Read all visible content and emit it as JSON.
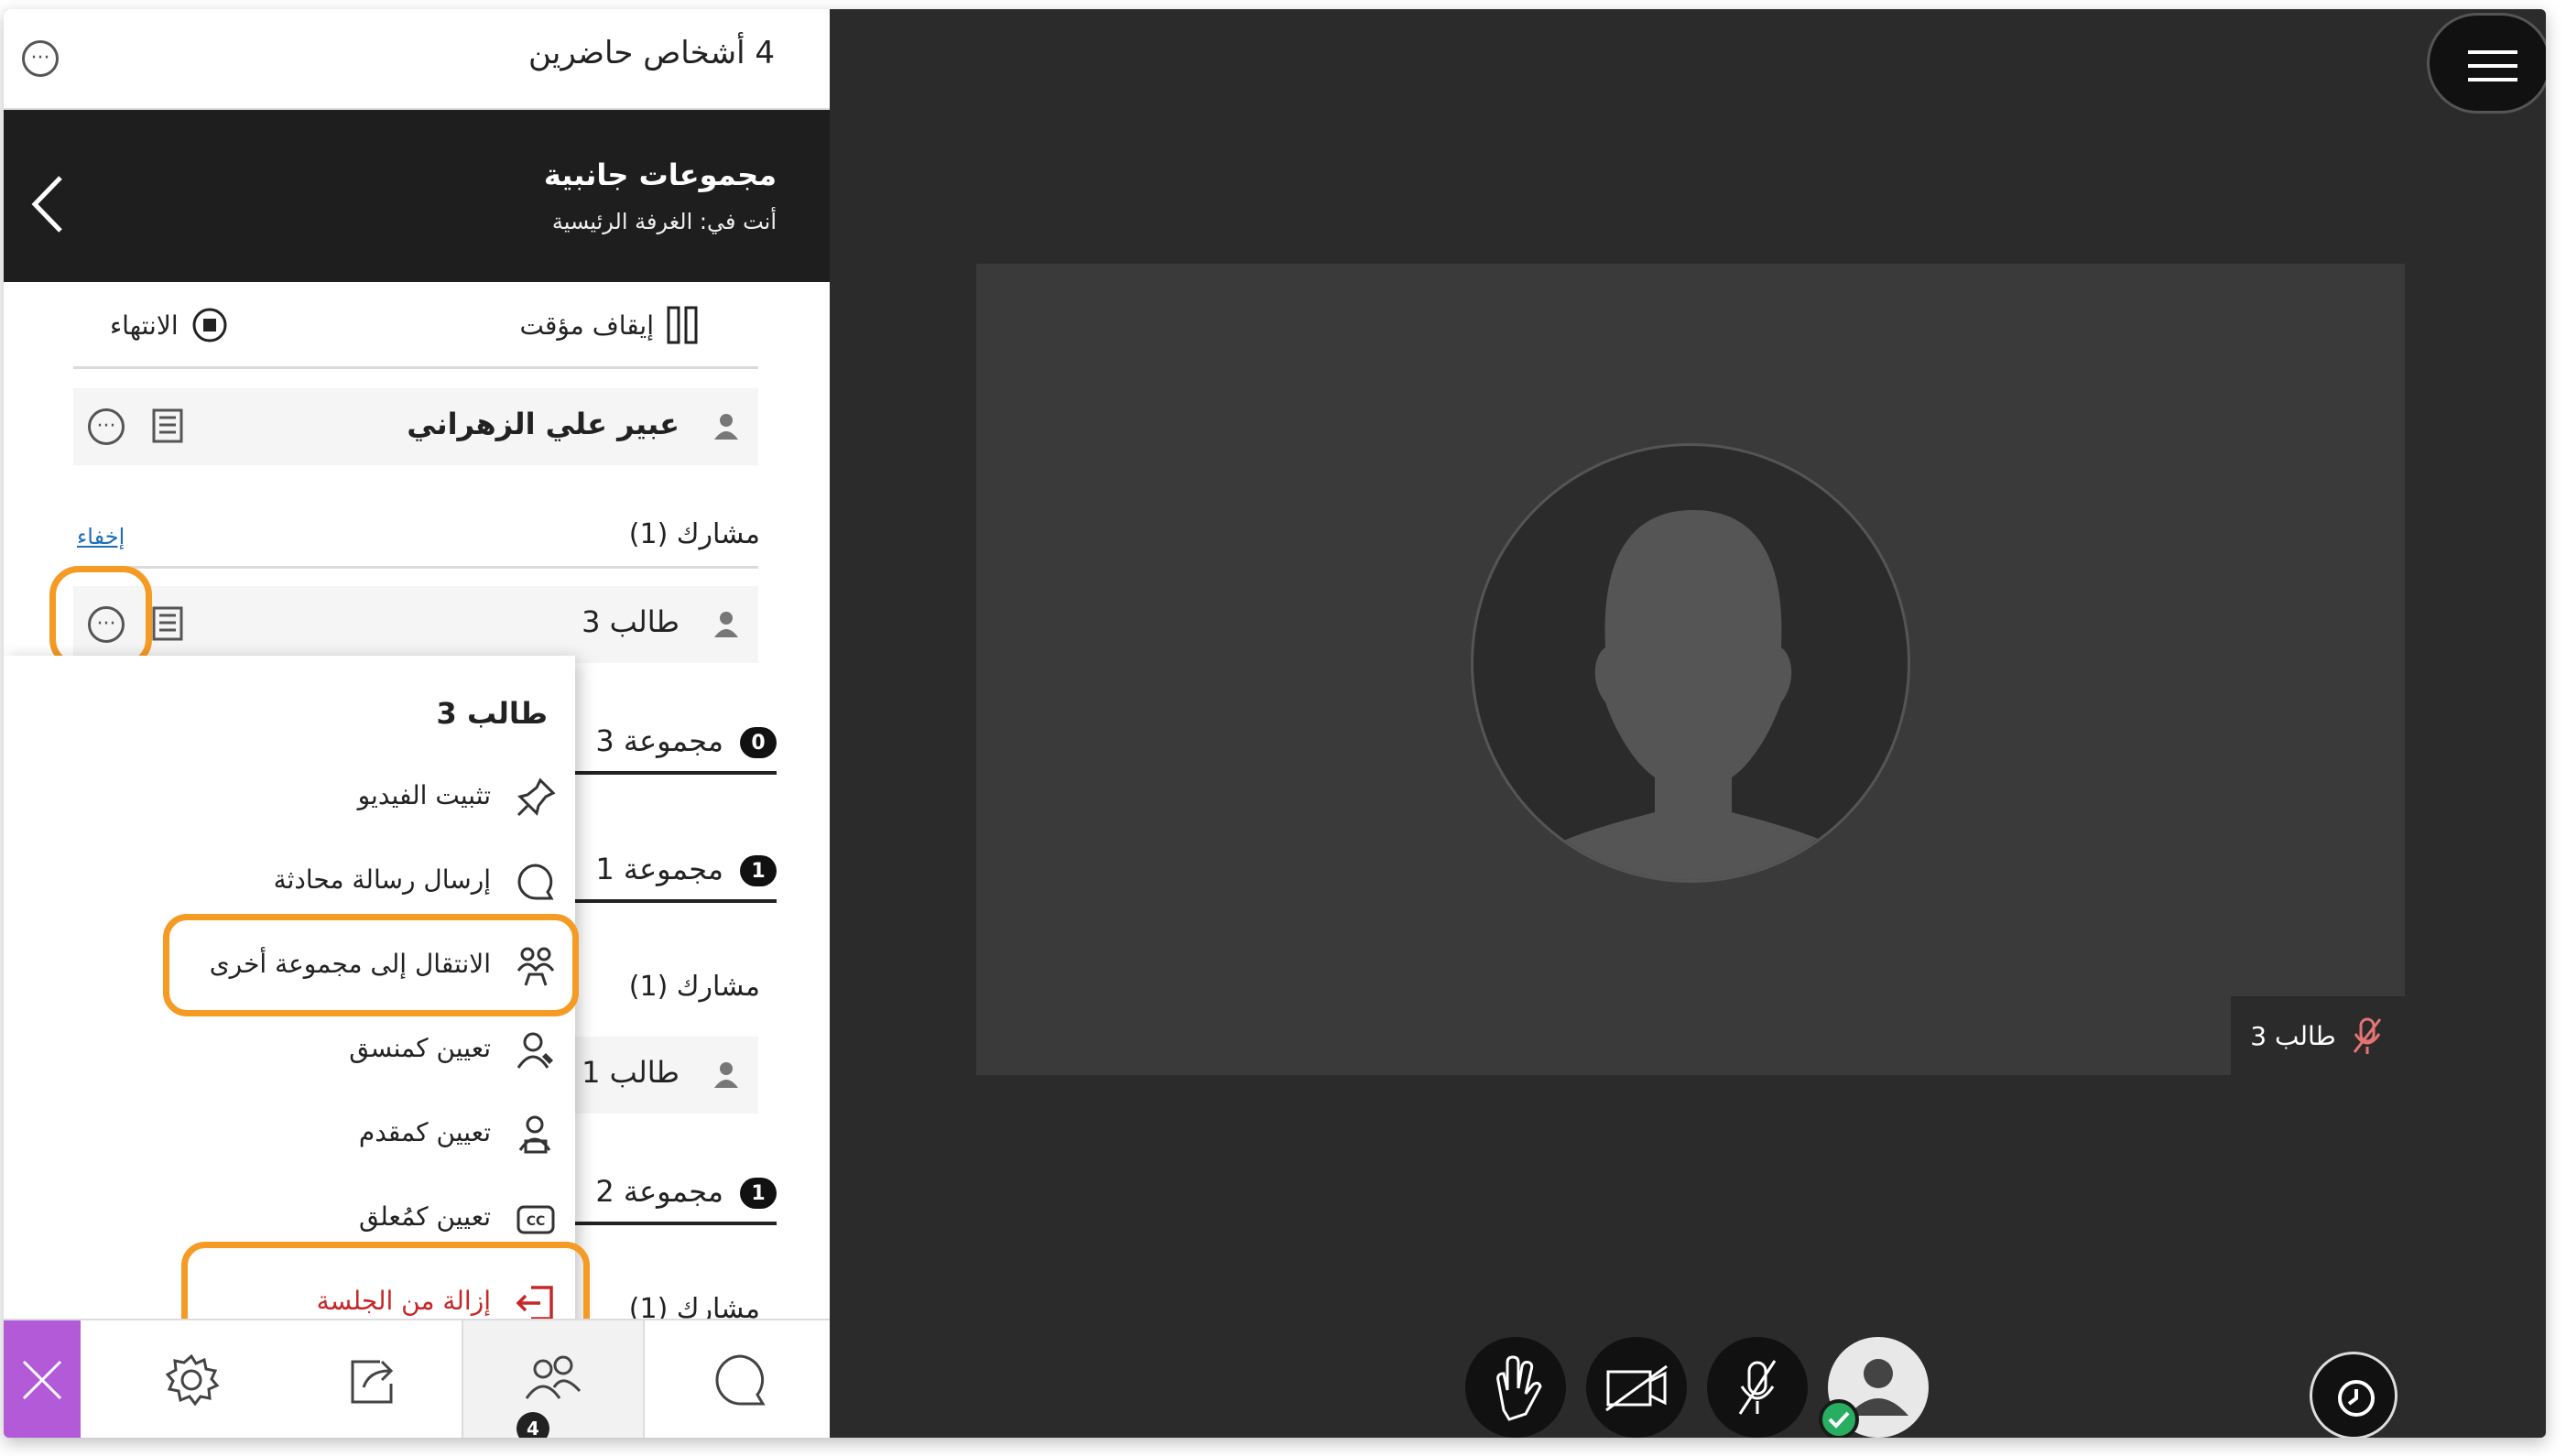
{
  "header": {
    "attendees_title": "4 أشخاص حاضرين"
  },
  "breakout": {
    "title": "مجموعات جانبية",
    "location": "أنت في: الغرفة الرئيسية"
  },
  "controls": {
    "pause_label": "إيقاف مؤقت",
    "end_label": "الانتهاء"
  },
  "facilitator": {
    "name": "عبير علي الزهراني"
  },
  "main_room": {
    "section_label": "مشارك (1)",
    "hide_label": "إخفاء",
    "participant": "طالب 3"
  },
  "groups": [
    {
      "badge": "0",
      "name": "مجموعة 3"
    },
    {
      "badge": "1",
      "name": "مجموعة 1",
      "section_label": "مشارك (1)",
      "participant": "طالب 1"
    },
    {
      "badge": "1",
      "name": "مجموعة 2",
      "section_label": "مشارك (1)"
    }
  ],
  "context_menu": {
    "title": "طالب 3",
    "items": [
      {
        "label": "تثبيت الفيديو",
        "icon": "pin-icon"
      },
      {
        "label": "إرسال رسالة محادثة",
        "icon": "chat-bubble-icon"
      },
      {
        "label": "الانتقال إلى مجموعة أخرى",
        "icon": "group-move-icon"
      },
      {
        "label": "تعيين كمنسق",
        "icon": "moderator-icon"
      },
      {
        "label": "تعيين كمقدم",
        "icon": "presenter-icon"
      },
      {
        "label": "تعيين كمُعلق",
        "icon": "captioner-icon"
      },
      {
        "label": "إزالة من الجلسة",
        "icon": "remove-exit-icon"
      }
    ]
  },
  "bottom_tabs": {
    "attendees_count": "4"
  },
  "video": {
    "participant_label": "طالب 3"
  },
  "colors": {
    "highlight": "#f59a23",
    "danger": "#c62828",
    "close_tab": "#b25ad8",
    "status_ok": "#27ae60"
  }
}
